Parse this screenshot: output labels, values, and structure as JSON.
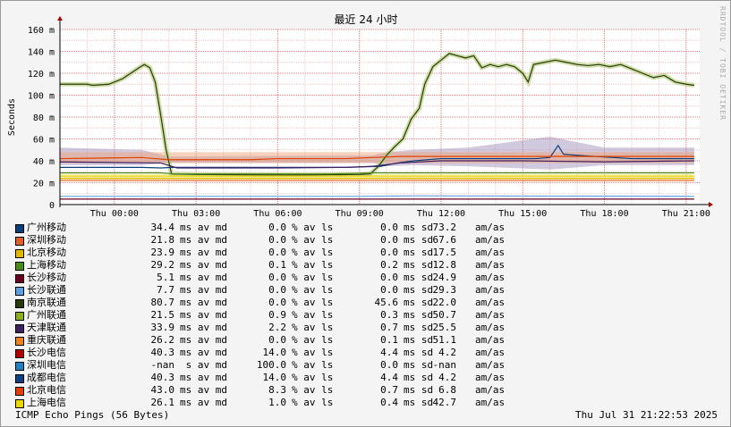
{
  "chart_data": {
    "type": "line",
    "title": "最近 24 小时",
    "ylabel": "Seconds",
    "ylim": [
      0,
      160
    ],
    "yticks": [
      "0",
      "20 m",
      "40 m",
      "60 m",
      "80 m",
      "100 m",
      "120 m",
      "140 m",
      "160 m"
    ],
    "ytick_values": [
      0,
      20,
      40,
      60,
      80,
      100,
      120,
      140,
      160
    ],
    "xlim": [
      -2,
      21.5
    ],
    "xticks": [
      "Thu 00:00",
      "Thu 03:00",
      "Thu 06:00",
      "Thu 09:00",
      "Thu 12:00",
      "Thu 15:00",
      "Thu 18:00",
      "Thu 21:00"
    ],
    "xtick_values": [
      0,
      3,
      6,
      9,
      12,
      15,
      18,
      21
    ],
    "grid": true,
    "series": [
      {
        "name": "南京联通",
        "color": "#2a3a0c",
        "points": [
          [
            -2,
            110
          ],
          [
            -1,
            110
          ],
          [
            -0.8,
            109
          ],
          [
            -0.2,
            110
          ],
          [
            0,
            112
          ],
          [
            0.3,
            115
          ],
          [
            0.6,
            120
          ],
          [
            0.9,
            125
          ],
          [
            1.1,
            128
          ],
          [
            1.3,
            125
          ],
          [
            1.5,
            112
          ],
          [
            1.7,
            82
          ],
          [
            1.9,
            50
          ],
          [
            2.1,
            28
          ],
          [
            3,
            27.5
          ],
          [
            5,
            27.2
          ],
          [
            7,
            27.1
          ],
          [
            8,
            27.3
          ],
          [
            9,
            27.5
          ],
          [
            9.4,
            28
          ],
          [
            9.7,
            35
          ],
          [
            10.0,
            45
          ],
          [
            10.3,
            53
          ],
          [
            10.6,
            60
          ],
          [
            10.9,
            78
          ],
          [
            11.2,
            88
          ],
          [
            11.4,
            110
          ],
          [
            11.7,
            126
          ],
          [
            12.0,
            132
          ],
          [
            12.3,
            138
          ],
          [
            12.6,
            136
          ],
          [
            12.9,
            134
          ],
          [
            13.2,
            136
          ],
          [
            13.5,
            125
          ],
          [
            13.8,
            128
          ],
          [
            14.1,
            126
          ],
          [
            14.4,
            128
          ],
          [
            14.7,
            126
          ],
          [
            15.0,
            120
          ],
          [
            15.2,
            112
          ],
          [
            15.4,
            128
          ],
          [
            15.8,
            130
          ],
          [
            16.2,
            132
          ],
          [
            16.6,
            130
          ],
          [
            17.0,
            128
          ],
          [
            17.4,
            127
          ],
          [
            17.8,
            128
          ],
          [
            18.2,
            126
          ],
          [
            18.6,
            128
          ],
          [
            19.0,
            124
          ],
          [
            19.4,
            120
          ],
          [
            19.8,
            116
          ],
          [
            20.2,
            118
          ],
          [
            20.6,
            112
          ],
          [
            21.0,
            110
          ],
          [
            21.3,
            109
          ]
        ]
      },
      {
        "name": "广州移动",
        "color": "#0b3d7a",
        "points": [
          [
            -2,
            34
          ],
          [
            1,
            34
          ],
          [
            1.7,
            33.5
          ],
          [
            2.1,
            34
          ],
          [
            5,
            34
          ],
          [
            6,
            34
          ],
          [
            8.5,
            34
          ],
          [
            9.8,
            35
          ],
          [
            10.4,
            38
          ],
          [
            11,
            40
          ],
          [
            12,
            42
          ],
          [
            13.5,
            42
          ],
          [
            15.5,
            42
          ],
          [
            16.0,
            43
          ],
          [
            16.3,
            54
          ],
          [
            16.5,
            46
          ],
          [
            17,
            45
          ],
          [
            19,
            42
          ],
          [
            21.3,
            42
          ]
        ]
      },
      {
        "name": "北京电信",
        "color": "#e04000",
        "points": [
          [
            -2,
            42
          ],
          [
            1,
            43
          ],
          [
            1.5,
            42
          ],
          [
            2,
            41
          ],
          [
            3,
            41
          ],
          [
            5,
            41
          ],
          [
            6,
            42
          ],
          [
            8.5,
            42
          ],
          [
            9.5,
            43
          ],
          [
            10.5,
            44
          ],
          [
            12,
            44
          ],
          [
            14,
            44
          ],
          [
            16,
            44
          ],
          [
            18,
            44
          ],
          [
            21.3,
            44
          ]
        ]
      },
      {
        "name": "天津联通",
        "color": "#402060",
        "points": [
          [
            -2,
            39
          ],
          [
            1.7,
            38
          ],
          [
            2.3,
            33.5
          ],
          [
            6,
            33.5
          ],
          [
            8.5,
            34
          ],
          [
            9.5,
            35
          ],
          [
            10.5,
            38
          ],
          [
            12,
            40
          ],
          [
            15,
            40
          ],
          [
            18,
            39
          ],
          [
            21.3,
            40
          ]
        ]
      },
      {
        "name": "上海移动",
        "color": "#4a8a1a",
        "points": [
          [
            -2,
            29
          ],
          [
            1.7,
            29
          ],
          [
            2.2,
            28
          ],
          [
            8,
            28
          ],
          [
            9.5,
            29
          ],
          [
            12,
            29
          ],
          [
            16,
            29
          ],
          [
            21.3,
            29
          ]
        ]
      },
      {
        "name": "上海电信",
        "color": "#e8d800",
        "points": [
          [
            -2,
            26
          ],
          [
            21.3,
            26
          ]
        ]
      },
      {
        "name": "北京移动",
        "color": "#e0b800",
        "points": [
          [
            -2,
            24
          ],
          [
            21.3,
            24
          ]
        ]
      },
      {
        "name": "深圳移动",
        "color": "#e0602a",
        "points": [
          [
            -2,
            22
          ],
          [
            21.3,
            22
          ]
        ]
      },
      {
        "name": "长沙联通",
        "color": "#60a0e0",
        "points": [
          [
            -2,
            7.5
          ],
          [
            9,
            7.5
          ],
          [
            11,
            8
          ],
          [
            21.3,
            7.5
          ]
        ]
      },
      {
        "name": "长沙移动",
        "color": "#6a0020",
        "points": [
          [
            -2,
            5
          ],
          [
            21.3,
            5
          ]
        ]
      }
    ],
    "bands": [
      {
        "color": "#9a88b4",
        "lo_hi": [
          [
            -2,
            36,
            52
          ],
          [
            1,
            36,
            50
          ],
          [
            2,
            38,
            44
          ],
          [
            9.5,
            38,
            45
          ],
          [
            10,
            35,
            48
          ],
          [
            11,
            36,
            50
          ],
          [
            13,
            35,
            52
          ],
          [
            16,
            32,
            62
          ],
          [
            18,
            36,
            52
          ],
          [
            21.3,
            36,
            52
          ]
        ]
      },
      {
        "color": "#f0a070",
        "lo_hi": [
          [
            -2,
            38,
            48
          ],
          [
            21.3,
            38,
            48
          ]
        ]
      },
      {
        "color": "#f0e060",
        "lo_hi": [
          [
            -2,
            22,
            28
          ],
          [
            21.3,
            22,
            28
          ]
        ]
      }
    ]
  },
  "legend": {
    "rows": [
      {
        "name": "广州移动",
        "color": "#0b3d7a",
        "avg": "34.4",
        "avg_unit": "ms av md",
        "loss": "0.0",
        "loss_unit": "% av ls",
        "sd": "0.0",
        "sd_unit": "ms sd",
        "am": "73.2",
        "am_unit": "am/as"
      },
      {
        "name": "深圳移动",
        "color": "#e0602a",
        "avg": "21.8",
        "avg_unit": "ms av md",
        "loss": "0.0",
        "loss_unit": "% av ls",
        "sd": "0.0",
        "sd_unit": "ms sd",
        "am": "67.6",
        "am_unit": "am/as"
      },
      {
        "name": "北京移动",
        "color": "#e0b800",
        "avg": "23.9",
        "avg_unit": "ms av md",
        "loss": "0.0",
        "loss_unit": "% av ls",
        "sd": "0.0",
        "sd_unit": "ms sd",
        "am": "17.5",
        "am_unit": "am/as"
      },
      {
        "name": "上海移动",
        "color": "#4a8a1a",
        "avg": "29.2",
        "avg_unit": "ms av md",
        "loss": "0.1",
        "loss_unit": "% av ls",
        "sd": "0.2",
        "sd_unit": "ms sd",
        "am": "12.8",
        "am_unit": "am/as"
      },
      {
        "name": "长沙移动",
        "color": "#6a0020",
        "avg": "5.1",
        "avg_unit": "ms av md",
        "loss": "0.0",
        "loss_unit": "% av ls",
        "sd": "0.0",
        "sd_unit": "ms sd",
        "am": "24.9",
        "am_unit": "am/as"
      },
      {
        "name": "长沙联通",
        "color": "#60a0e0",
        "avg": "7.7",
        "avg_unit": "ms av md",
        "loss": "0.0",
        "loss_unit": "% av ls",
        "sd": "0.0",
        "sd_unit": "ms sd",
        "am": "29.3",
        "am_unit": "am/as"
      },
      {
        "name": "南京联通",
        "color": "#2a3a0c",
        "avg": "80.7",
        "avg_unit": "ms av md",
        "loss": "0.0",
        "loss_unit": "% av ls",
        "sd": "45.6",
        "sd_unit": "ms sd",
        "am": "22.0",
        "am_unit": "am/as"
      },
      {
        "name": "广州联通",
        "color": "#8ab020",
        "avg": "21.5",
        "avg_unit": "ms av md",
        "loss": "0.9",
        "loss_unit": "% av ls",
        "sd": "0.3",
        "sd_unit": "ms sd",
        "am": "50.7",
        "am_unit": "am/as"
      },
      {
        "name": "天津联通",
        "color": "#402060",
        "avg": "33.9",
        "avg_unit": "ms av md",
        "loss": "2.2",
        "loss_unit": "% av ls",
        "sd": "0.7",
        "sd_unit": "ms sd",
        "am": "25.5",
        "am_unit": "am/as"
      },
      {
        "name": "重庆联通",
        "color": "#f08020",
        "avg": "26.2",
        "avg_unit": "ms av md",
        "loss": "0.0",
        "loss_unit": "% av ls",
        "sd": "0.1",
        "sd_unit": "ms sd",
        "am": "51.1",
        "am_unit": "am/as"
      },
      {
        "name": "长沙电信",
        "color": "#b00000",
        "avg": "40.3",
        "avg_unit": "ms av md",
        "loss": "14.0",
        "loss_unit": "% av ls",
        "sd": "4.4",
        "sd_unit": "ms sd",
        "am": "4.2",
        "am_unit": "am/as"
      },
      {
        "name": "深圳电信",
        "color": "#2080c0",
        "avg": "-nan",
        "avg_unit": " s av md",
        "loss": "100.0",
        "loss_unit": "% av ls",
        "sd": "0.0",
        "sd_unit": "ms sd",
        "am": "-nan",
        "am_unit": "am/as"
      },
      {
        "name": "成都电信",
        "color": "#104080",
        "avg": "40.3",
        "avg_unit": "ms av md",
        "loss": "14.0",
        "loss_unit": "% av ls",
        "sd": "4.4",
        "sd_unit": "ms sd",
        "am": "4.2",
        "am_unit": "am/as"
      },
      {
        "name": "北京电信",
        "color": "#e04000",
        "avg": "43.0",
        "avg_unit": "ms av md",
        "loss": "8.3",
        "loss_unit": "% av ls",
        "sd": "0.7",
        "sd_unit": "ms sd",
        "am": "6.8",
        "am_unit": "am/as"
      },
      {
        "name": "上海电信",
        "color": "#e8d800",
        "avg": "26.1",
        "avg_unit": "ms av md",
        "loss": "1.0",
        "loss_unit": "% av ls",
        "sd": "0.4",
        "sd_unit": "ms sd",
        "am": "42.7",
        "am_unit": "am/as"
      }
    ]
  },
  "footer": {
    "left": "ICMP Echo Pings (56 Bytes)",
    "right": "Thu Jul 31 21:22:53 2025"
  },
  "side_label": "RRDTOOL / TOBI OETIKER"
}
